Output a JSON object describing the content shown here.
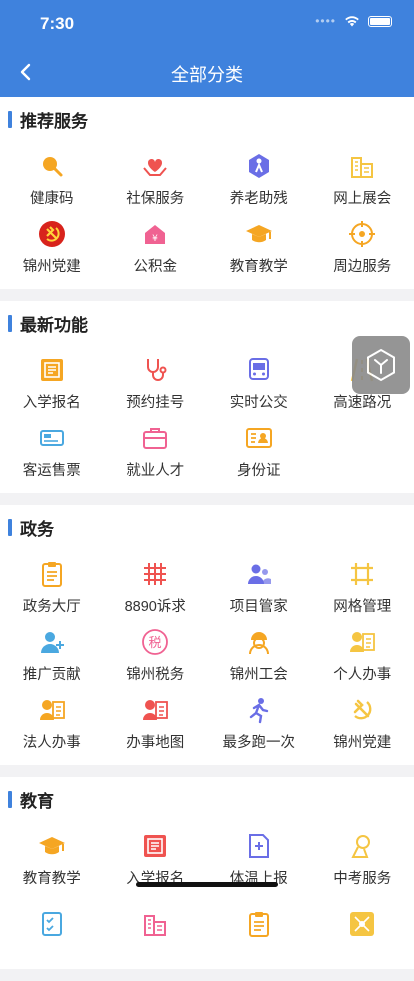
{
  "status": {
    "time": "7:30"
  },
  "header": {
    "title": "全部分类"
  },
  "sections": [
    {
      "title": "推荐服务",
      "items": [
        {
          "label": "健康码",
          "icon": "search-icon",
          "color": "#f5a623"
        },
        {
          "label": "社保服务",
          "icon": "heart-hands-icon",
          "color": "#ef5350"
        },
        {
          "label": "养老助残",
          "icon": "elderly-icon",
          "color": "#6a6ee6"
        },
        {
          "label": "网上展会",
          "icon": "building-icon",
          "color": "#f5c542"
        },
        {
          "label": "锦州党建",
          "icon": "party-emblem-icon",
          "color": "#d8231c"
        },
        {
          "label": "公积金",
          "icon": "house-fund-icon",
          "color": "#f06292"
        },
        {
          "label": "教育教学",
          "icon": "graduation-cap-icon",
          "color": "#f5a623"
        },
        {
          "label": "周边服务",
          "icon": "location-target-icon",
          "color": "#f5a623"
        }
      ]
    },
    {
      "title": "最新功能",
      "items": [
        {
          "label": "入学报名",
          "icon": "registration-form-icon",
          "color": "#f5a623"
        },
        {
          "label": "预约挂号",
          "icon": "stethoscope-icon",
          "color": "#ef5350"
        },
        {
          "label": "实时公交",
          "icon": "bus-icon",
          "color": "#6a6ee6"
        },
        {
          "label": "高速路况",
          "icon": "road-icon",
          "color": "#f5c542"
        },
        {
          "label": "客运售票",
          "icon": "ticket-icon",
          "color": "#4aa8e0"
        },
        {
          "label": "就业人才",
          "icon": "briefcase-icon",
          "color": "#f06292"
        },
        {
          "label": "身份证",
          "icon": "id-card-icon",
          "color": "#f5a623"
        }
      ]
    },
    {
      "title": "政务",
      "items": [
        {
          "label": "政务大厅",
          "icon": "clipboard-icon",
          "color": "#f5a623"
        },
        {
          "label": "8890诉求",
          "icon": "grid-hash-icon",
          "color": "#ef5350"
        },
        {
          "label": "项目管家",
          "icon": "people-icon",
          "color": "#6a6ee6"
        },
        {
          "label": "网格管理",
          "icon": "grid-frame-icon",
          "color": "#f5c542"
        },
        {
          "label": "推广贡献",
          "icon": "user-add-icon",
          "color": "#4aa8e0"
        },
        {
          "label": "锦州税务",
          "icon": "tax-icon",
          "color": "#f06292"
        },
        {
          "label": "锦州工会",
          "icon": "worker-icon",
          "color": "#f5a623"
        },
        {
          "label": "个人办事",
          "icon": "person-card-icon",
          "color": "#f5c542"
        },
        {
          "label": "法人办事",
          "icon": "person-card-icon",
          "color": "#f5a623"
        },
        {
          "label": "办事地图",
          "icon": "person-card-icon",
          "color": "#ef5350"
        },
        {
          "label": "最多跑一次",
          "icon": "runner-icon",
          "color": "#6a6ee6"
        },
        {
          "label": "锦州党建",
          "icon": "hammer-sickle-icon",
          "color": "#f5c542"
        }
      ]
    },
    {
      "title": "教育",
      "items": [
        {
          "label": "教育教学",
          "icon": "graduation-cap-icon",
          "color": "#f5a623"
        },
        {
          "label": "入学报名",
          "icon": "registration-form-icon",
          "color": "#ef5350"
        },
        {
          "label": "体温上报",
          "icon": "medical-doc-icon",
          "color": "#6a6ee6"
        },
        {
          "label": "中考服务",
          "icon": "exam-icon",
          "color": "#f5c542"
        },
        {
          "label": "",
          "icon": "checklist-icon",
          "color": "#4aa8e0"
        },
        {
          "label": "",
          "icon": "building-icon",
          "color": "#f06292"
        },
        {
          "label": "",
          "icon": "clipboard-icon",
          "color": "#f5a623"
        },
        {
          "label": "",
          "icon": "network-icon",
          "color": "#f5c542"
        }
      ]
    }
  ]
}
